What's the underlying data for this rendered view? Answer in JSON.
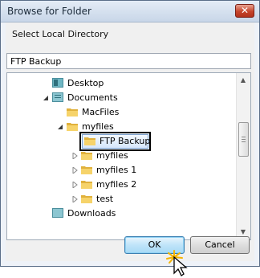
{
  "window": {
    "title": "Browse for Folder",
    "close_glyph": "✕"
  },
  "prompt": "Select Local Directory",
  "path_input": {
    "value": "FTP Backup"
  },
  "tree": {
    "items": [
      {
        "label": "Desktop",
        "icon": "desktop-folder-icon",
        "expander": "none"
      },
      {
        "label": "Documents",
        "icon": "documents-folder-icon",
        "expander": "expanded"
      },
      {
        "label": "MacFiles",
        "icon": "folder-icon",
        "expander": "none"
      },
      {
        "label": "myfiles",
        "icon": "folder-icon",
        "expander": "expanded"
      },
      {
        "label": "FTP Backup",
        "icon": "folder-icon",
        "expander": "none",
        "selected": true
      },
      {
        "label": "myfiles",
        "icon": "folder-icon",
        "expander": "collapsed"
      },
      {
        "label": "myfiles 1",
        "icon": "folder-icon",
        "expander": "collapsed"
      },
      {
        "label": "myfiles 2",
        "icon": "folder-icon",
        "expander": "collapsed"
      },
      {
        "label": "test",
        "icon": "folder-icon",
        "expander": "collapsed"
      },
      {
        "label": "Downloads",
        "icon": "downloads-folder-icon",
        "expander": "none"
      }
    ]
  },
  "buttons": {
    "ok": "OK",
    "cancel": "Cancel"
  },
  "colors": {
    "selection_outline": "#000000",
    "folder": "#f2c94c",
    "ok_button": "#bfe4f9"
  }
}
